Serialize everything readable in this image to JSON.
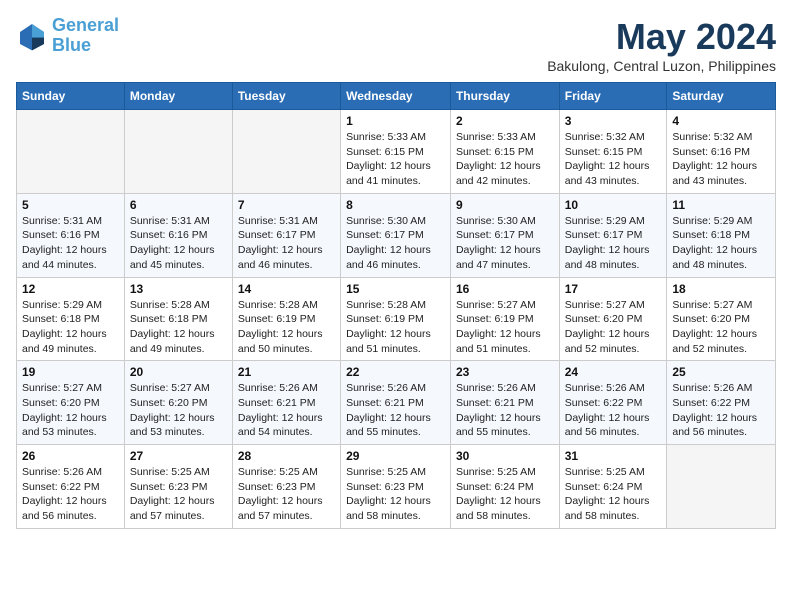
{
  "header": {
    "logo_line1": "General",
    "logo_line2": "Blue",
    "month": "May 2024",
    "location": "Bakulong, Central Luzon, Philippines"
  },
  "weekdays": [
    "Sunday",
    "Monday",
    "Tuesday",
    "Wednesday",
    "Thursday",
    "Friday",
    "Saturday"
  ],
  "weeks": [
    [
      {
        "day": "",
        "info": ""
      },
      {
        "day": "",
        "info": ""
      },
      {
        "day": "",
        "info": ""
      },
      {
        "day": "1",
        "info": "Sunrise: 5:33 AM\nSunset: 6:15 PM\nDaylight: 12 hours\nand 41 minutes."
      },
      {
        "day": "2",
        "info": "Sunrise: 5:33 AM\nSunset: 6:15 PM\nDaylight: 12 hours\nand 42 minutes."
      },
      {
        "day": "3",
        "info": "Sunrise: 5:32 AM\nSunset: 6:15 PM\nDaylight: 12 hours\nand 43 minutes."
      },
      {
        "day": "4",
        "info": "Sunrise: 5:32 AM\nSunset: 6:16 PM\nDaylight: 12 hours\nand 43 minutes."
      }
    ],
    [
      {
        "day": "5",
        "info": "Sunrise: 5:31 AM\nSunset: 6:16 PM\nDaylight: 12 hours\nand 44 minutes."
      },
      {
        "day": "6",
        "info": "Sunrise: 5:31 AM\nSunset: 6:16 PM\nDaylight: 12 hours\nand 45 minutes."
      },
      {
        "day": "7",
        "info": "Sunrise: 5:31 AM\nSunset: 6:17 PM\nDaylight: 12 hours\nand 46 minutes."
      },
      {
        "day": "8",
        "info": "Sunrise: 5:30 AM\nSunset: 6:17 PM\nDaylight: 12 hours\nand 46 minutes."
      },
      {
        "day": "9",
        "info": "Sunrise: 5:30 AM\nSunset: 6:17 PM\nDaylight: 12 hours\nand 47 minutes."
      },
      {
        "day": "10",
        "info": "Sunrise: 5:29 AM\nSunset: 6:17 PM\nDaylight: 12 hours\nand 48 minutes."
      },
      {
        "day": "11",
        "info": "Sunrise: 5:29 AM\nSunset: 6:18 PM\nDaylight: 12 hours\nand 48 minutes."
      }
    ],
    [
      {
        "day": "12",
        "info": "Sunrise: 5:29 AM\nSunset: 6:18 PM\nDaylight: 12 hours\nand 49 minutes."
      },
      {
        "day": "13",
        "info": "Sunrise: 5:28 AM\nSunset: 6:18 PM\nDaylight: 12 hours\nand 49 minutes."
      },
      {
        "day": "14",
        "info": "Sunrise: 5:28 AM\nSunset: 6:19 PM\nDaylight: 12 hours\nand 50 minutes."
      },
      {
        "day": "15",
        "info": "Sunrise: 5:28 AM\nSunset: 6:19 PM\nDaylight: 12 hours\nand 51 minutes."
      },
      {
        "day": "16",
        "info": "Sunrise: 5:27 AM\nSunset: 6:19 PM\nDaylight: 12 hours\nand 51 minutes."
      },
      {
        "day": "17",
        "info": "Sunrise: 5:27 AM\nSunset: 6:20 PM\nDaylight: 12 hours\nand 52 minutes."
      },
      {
        "day": "18",
        "info": "Sunrise: 5:27 AM\nSunset: 6:20 PM\nDaylight: 12 hours\nand 52 minutes."
      }
    ],
    [
      {
        "day": "19",
        "info": "Sunrise: 5:27 AM\nSunset: 6:20 PM\nDaylight: 12 hours\nand 53 minutes."
      },
      {
        "day": "20",
        "info": "Sunrise: 5:27 AM\nSunset: 6:20 PM\nDaylight: 12 hours\nand 53 minutes."
      },
      {
        "day": "21",
        "info": "Sunrise: 5:26 AM\nSunset: 6:21 PM\nDaylight: 12 hours\nand 54 minutes."
      },
      {
        "day": "22",
        "info": "Sunrise: 5:26 AM\nSunset: 6:21 PM\nDaylight: 12 hours\nand 55 minutes."
      },
      {
        "day": "23",
        "info": "Sunrise: 5:26 AM\nSunset: 6:21 PM\nDaylight: 12 hours\nand 55 minutes."
      },
      {
        "day": "24",
        "info": "Sunrise: 5:26 AM\nSunset: 6:22 PM\nDaylight: 12 hours\nand 56 minutes."
      },
      {
        "day": "25",
        "info": "Sunrise: 5:26 AM\nSunset: 6:22 PM\nDaylight: 12 hours\nand 56 minutes."
      }
    ],
    [
      {
        "day": "26",
        "info": "Sunrise: 5:26 AM\nSunset: 6:22 PM\nDaylight: 12 hours\nand 56 minutes."
      },
      {
        "day": "27",
        "info": "Sunrise: 5:25 AM\nSunset: 6:23 PM\nDaylight: 12 hours\nand 57 minutes."
      },
      {
        "day": "28",
        "info": "Sunrise: 5:25 AM\nSunset: 6:23 PM\nDaylight: 12 hours\nand 57 minutes."
      },
      {
        "day": "29",
        "info": "Sunrise: 5:25 AM\nSunset: 6:23 PM\nDaylight: 12 hours\nand 58 minutes."
      },
      {
        "day": "30",
        "info": "Sunrise: 5:25 AM\nSunset: 6:24 PM\nDaylight: 12 hours\nand 58 minutes."
      },
      {
        "day": "31",
        "info": "Sunrise: 5:25 AM\nSunset: 6:24 PM\nDaylight: 12 hours\nand 58 minutes."
      },
      {
        "day": "",
        "info": ""
      }
    ]
  ]
}
